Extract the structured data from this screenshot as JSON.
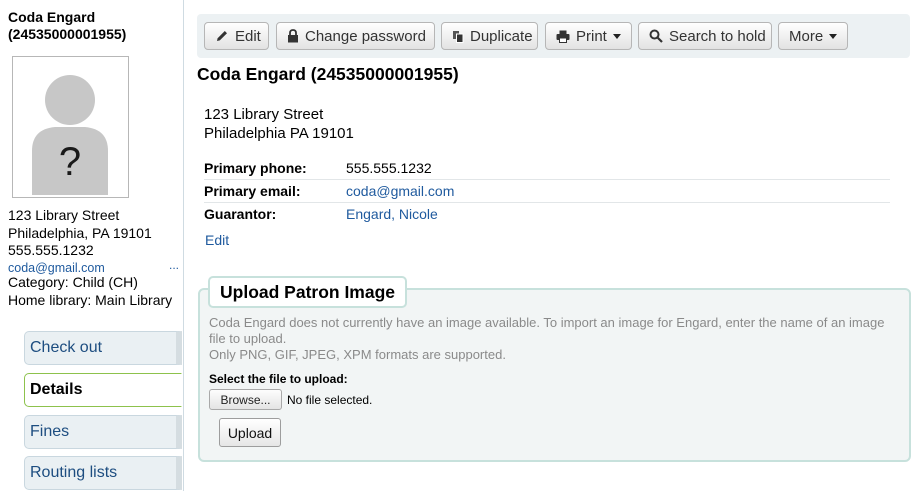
{
  "patron": {
    "name_line1": "Coda Engard",
    "name_line2": "(24535000001955)",
    "full_title": "Coda Engard (24535000001955)"
  },
  "sidebar": {
    "photo_placeholder": "?",
    "address_line1": "123 Library Street",
    "address_line2": "Philadelphia, PA 19101",
    "phone": "555.555.1232",
    "email": "coda@gmail.com",
    "more_dots": "...",
    "category": "Category: Child (CH)",
    "home_library": "Home library: Main Library",
    "nav": [
      {
        "label": "Check out",
        "active": false
      },
      {
        "label": "Details",
        "active": true
      },
      {
        "label": "Fines",
        "active": false
      },
      {
        "label": "Routing lists",
        "active": false
      }
    ]
  },
  "toolbar": {
    "edit": "Edit",
    "change_password": "Change password",
    "duplicate": "Duplicate",
    "print": "Print",
    "search_to_hold": "Search to hold",
    "more": "More"
  },
  "details": {
    "address_line1": "123 Library Street",
    "address_line2": "Philadelphia PA 19101",
    "rows": [
      {
        "label": "Primary phone:",
        "value": "555.555.1232"
      },
      {
        "label": "Primary email:",
        "value": "coda@gmail.com"
      },
      {
        "label": "Guarantor:",
        "value": "Engard, Nicole"
      }
    ],
    "edit_link": "Edit"
  },
  "upload": {
    "legend": "Upload Patron Image",
    "message_line1": "Coda Engard does not currently have an image available. To import an image for Engard, enter the name of an image file to upload.",
    "message_line2": "Only PNG, GIF, JPEG, XPM formats are supported.",
    "select_label": "Select the file to upload:",
    "browse_label": "Browse...",
    "no_file_text": "No file selected.",
    "upload_label": "Upload"
  },
  "colors": {
    "link": "#1f5a9e",
    "active_tab_border": "#8dc24c",
    "toolbar_bg": "#ecf1f3",
    "panel_border": "#c7e1dc"
  }
}
